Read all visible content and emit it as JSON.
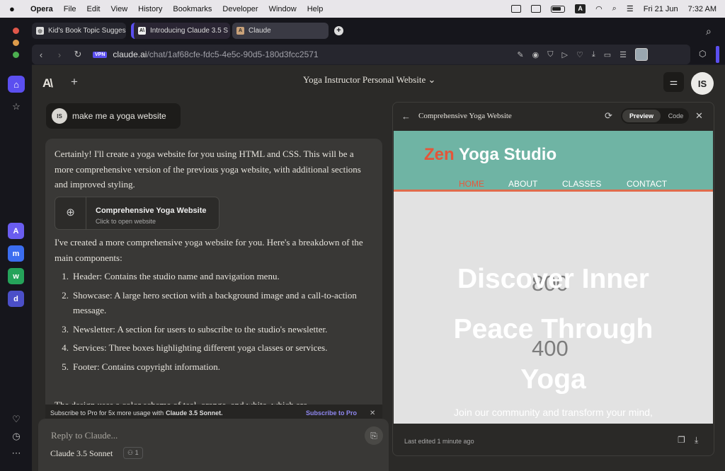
{
  "menubar": {
    "app": "Opera",
    "items": [
      "File",
      "Edit",
      "View",
      "History",
      "Bookmarks",
      "Developer",
      "Window",
      "Help"
    ],
    "date": "Fri 21 Jun",
    "time": "7:32 AM"
  },
  "tabs": [
    {
      "label": "Kid's Book Topic Sugges",
      "favicon": "globe-icon"
    },
    {
      "label": "Introducing Claude 3.5 S",
      "favicon": "anthropic-icon"
    },
    {
      "label": "Claude",
      "favicon": "claude-icon"
    }
  ],
  "address": {
    "vpn": "VPN",
    "host": "claude.ai",
    "path": "/chat/1af68cfe-fdc5-4e5c-90d5-180d3fcc2571"
  },
  "claude": {
    "logo": "A\\",
    "conversation_title": "Yoga Instructor Personal Website",
    "avatar_initials": "IS",
    "user_message": "make me a yoga website",
    "intro": "Certainly! I'll create a yoga website for you using HTML and CSS. This will be a more comprehensive version of the previous yoga website, with additional sections and improved styling.",
    "artifact_title": "Comprehensive Yoga Website",
    "artifact_subtitle": "Click to open website",
    "after": "I've created a more comprehensive yoga website for you. Here's a breakdown of the main components:",
    "list": [
      {
        "n": "1.",
        "text": "Header: Contains the studio name and navigation menu."
      },
      {
        "n": "2.",
        "text": "Showcase: A large hero section with a background image and a call-to-action message."
      },
      {
        "n": "3.",
        "text": "Newsletter: A section for users to subscribe to the studio's newsletter."
      },
      {
        "n": "4.",
        "text": "Services: Three boxes highlighting different yoga classes or services."
      },
      {
        "n": "5.",
        "text": "Footer: Contains copyright information."
      }
    ],
    "tail": "The design uses a color scheme of teal, orange, and white, which are",
    "upsell": "Subscribe to Pro for 5x more usage with",
    "upsell_model": "Claude 3.5 Sonnet.",
    "upsell_cta": "Subscribe to Pro",
    "input_placeholder": "Reply to Claude...",
    "model_name": "Claude 3.5 Sonnet",
    "users_count": "1"
  },
  "panel": {
    "title": "Comprehensive Yoga Website",
    "preview_label": "Preview",
    "code_label": "Code",
    "last_edited": "Last edited 1 minute ago"
  },
  "yoga": {
    "logo_accent": "Zen",
    "logo_rest": "Yoga Studio",
    "nav": [
      "HOME",
      "ABOUT",
      "CLASSES",
      "CONTACT"
    ],
    "hero_lines": [
      "Discover Inner",
      "Peace Through",
      "Yoga"
    ],
    "ghost_1": "800",
    "ghost_2": "400",
    "tagline": "Join our community and transform your mind,"
  },
  "colors": {
    "accent_purple": "#5b4ff0",
    "yoga_teal": "#6fb4a4",
    "yoga_orange": "#e3563a"
  }
}
